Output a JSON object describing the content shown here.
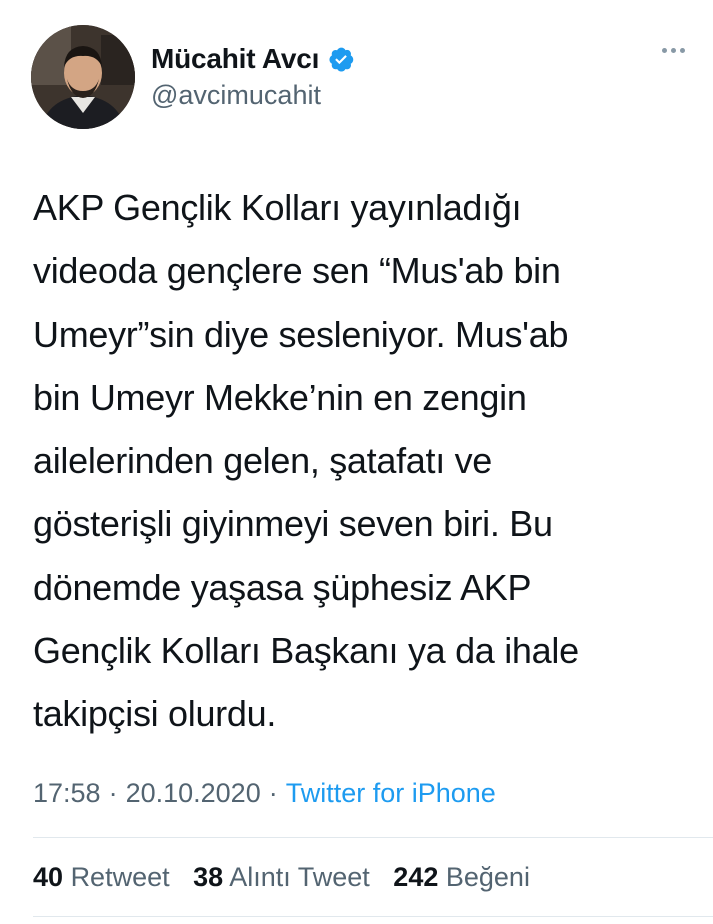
{
  "author": {
    "name": "Mücahit Avcı",
    "handle": "@avcimucahit",
    "verified": true
  },
  "tweet": {
    "lines": [
      "AKP Gençlik Kolları yayınladığı",
      "videoda gençlere sen “Mus'ab bin",
      "Umeyr”sin diye sesleniyor. Mus'ab",
      "bin Umeyr Mekke’nin en zengin",
      "ailelerinden gelen, şatafatı ve",
      "gösterişli giyinmeyi seven biri. Bu",
      "dönemde yaşasa şüphesiz AKP",
      "Gençlik Kolları Başkanı ya da ihale",
      "takipçisi olurdu."
    ],
    "time": "17:58",
    "date": "20.10.2020",
    "separator": "·",
    "source": "Twitter for iPhone"
  },
  "stats": {
    "retweets_count": "40",
    "retweets_label": "Retweet",
    "quotes_count": "38",
    "quotes_label": "Alıntı Tweet",
    "likes_count": "242",
    "likes_label": "Beğeni"
  },
  "colors": {
    "text": "#0f1419",
    "secondary": "#536471",
    "link": "#1d9bf0",
    "divider": "#e1e8ed"
  },
  "icons": {
    "verified": "verified-badge-icon",
    "more": "more-horizontal-icon"
  }
}
